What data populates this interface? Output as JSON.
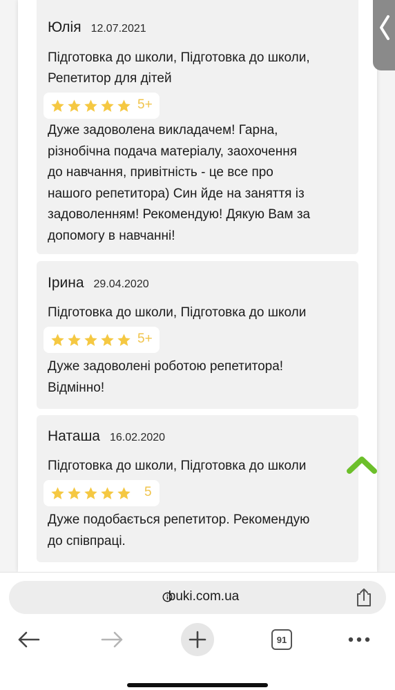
{
  "reviews": [
    {
      "name": "Юлія",
      "date": "12.07.2021",
      "subject_lines": [
        "Підготовка до школи, Підготовка до школи,",
        "Репетитор для дітей"
      ],
      "stars": 5,
      "rating_label": "5+",
      "text_lines": [
        "Дуже задоволена викладачем! Гарна,",
        "різнобічна подача матеріалу, заохочення",
        "до навчання, привітність - це все про",
        "нашого репетитора) Син йде на заняття із",
        "задоволенням! Рекомендую! Дякую Вам за",
        "допомогу в навчанні!"
      ]
    },
    {
      "name": "Ірина",
      "date": "29.04.2020",
      "subject_lines": [
        "Підготовка до школи, Підготовка до школи"
      ],
      "stars": 5,
      "rating_label": "5+",
      "text_lines": [
        "Дуже задоволені роботою репетитора!",
        "Відмінно!"
      ]
    },
    {
      "name": "Наташа",
      "date": "16.02.2020",
      "subject_lines": [
        "Підготовка до школи, Підготовка до школи"
      ],
      "stars": 5,
      "rating_label": "5",
      "text_lines": [
        "Дуже подобається репетитор. Рекомендую",
        "до співпраці."
      ]
    }
  ],
  "browser": {
    "url": "buki.com.ua",
    "tab_count": "91"
  },
  "icons": {
    "side_tab": "chevron-left-icon",
    "scroll_top": "chevron-up-icon",
    "address_info": "info-icon",
    "share": "share-icon",
    "back": "arrow-left-icon",
    "forward": "arrow-right-icon",
    "new_tab": "plus-icon",
    "tabs": "tabs-icon",
    "more": "more-dots-icon"
  },
  "colors": {
    "star": "#f5c842",
    "rating_text": "#f0c44c",
    "scroll_top": "#6cbf2a",
    "side_tab": "#8a8a8a",
    "card_bg": "#f1f1f1"
  }
}
